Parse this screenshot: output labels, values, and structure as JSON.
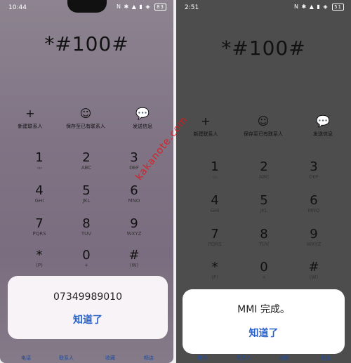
{
  "left": {
    "status": {
      "time": "10:44",
      "icons": "N ✱ ▲ ▮ ◈",
      "battery": "83"
    },
    "dial_number": "*#100#",
    "actions": [
      {
        "icon": "+",
        "label": "新建联系人"
      },
      {
        "icon": "☺",
        "label": "保存至已有联系人"
      },
      {
        "icon": "💬",
        "label": "发送信息"
      }
    ],
    "keys": [
      {
        "digit": "1",
        "letters": "ထ"
      },
      {
        "digit": "2",
        "letters": "ABC"
      },
      {
        "digit": "3",
        "letters": "DEF"
      },
      {
        "digit": "4",
        "letters": "GHI"
      },
      {
        "digit": "5",
        "letters": "JKL"
      },
      {
        "digit": "6",
        "letters": "MNO"
      },
      {
        "digit": "7",
        "letters": "PQRS"
      },
      {
        "digit": "8",
        "letters": "TUV"
      },
      {
        "digit": "9",
        "letters": "WXYZ"
      },
      {
        "digit": "*",
        "letters": "(P)"
      },
      {
        "digit": "0",
        "letters": "+"
      },
      {
        "digit": "#",
        "letters": "(W)"
      }
    ],
    "dialog": {
      "message": "07349989010",
      "ok": "知道了"
    },
    "bottom_tabs": [
      "电话",
      "联系人",
      "收藏",
      "畅连"
    ]
  },
  "right": {
    "status": {
      "time": "2:51",
      "icons": "N ✱ ▲ ▮ ◈",
      "battery": "51"
    },
    "dial_number": "*#100#",
    "actions": [
      {
        "icon": "+",
        "label": "新建联系人"
      },
      {
        "icon": "☺",
        "label": "保存至已有联系人"
      },
      {
        "icon": "💬",
        "label": "发送信息"
      }
    ],
    "keys": [
      {
        "digit": "1",
        "letters": "ထ"
      },
      {
        "digit": "2",
        "letters": "ABC"
      },
      {
        "digit": "3",
        "letters": "DEF"
      },
      {
        "digit": "4",
        "letters": "GHI"
      },
      {
        "digit": "5",
        "letters": "JKL"
      },
      {
        "digit": "6",
        "letters": "MNO"
      },
      {
        "digit": "7",
        "letters": "PQRS"
      },
      {
        "digit": "8",
        "letters": "TUV"
      },
      {
        "digit": "9",
        "letters": "WXYZ"
      },
      {
        "digit": "*",
        "letters": "(P)"
      },
      {
        "digit": "0",
        "letters": "+"
      },
      {
        "digit": "#",
        "letters": "(W)"
      }
    ],
    "dialog": {
      "message": "MMI 完成。",
      "ok": "知道了"
    },
    "bottom_tabs": [
      "电话",
      "联系人",
      "收藏",
      "畅连"
    ]
  },
  "watermark": "kakanote.com"
}
